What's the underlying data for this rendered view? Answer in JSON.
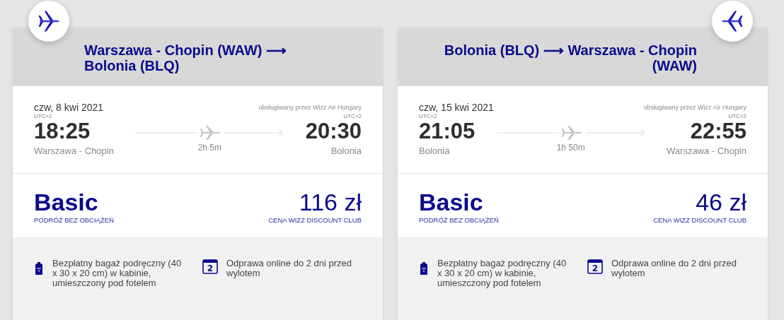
{
  "flights": [
    {
      "kind": "outbound",
      "route": "Warszawa - Chopin (WAW) ⟶ Bolonia (BLQ)",
      "date": "czw, 8 kwi 2021",
      "operator": "obsługiwany przez Wizz Air Hungary",
      "departure": {
        "tz": "UTC+2",
        "time": "18:25",
        "place": "Warszawa - Chopin"
      },
      "duration": "2h 5m",
      "arrival": {
        "tz": "UTC+2",
        "time": "20:30",
        "place": "Bolonia"
      },
      "fare": {
        "name": "Basic",
        "subtitle": "PODRÓŻ BEZ OBCIĄŻEŃ",
        "price": "116 zł",
        "price_note": "CENA WIZZ DISCOUNT CLUB"
      },
      "features": [
        {
          "kind": "baggage",
          "text": "Bezpłatny bagaż podręczny (40 x 30 x 20 cm) w kabinie, umieszczony pod fotelem"
        },
        {
          "kind": "checkin",
          "icon_text": "2",
          "text": "Odprawa online do 2 dni przed wylotem"
        }
      ]
    },
    {
      "kind": "return",
      "route": "Bolonia (BLQ) ⟶ Warszawa - Chopin (WAW)",
      "date": "czw, 15 kwi 2021",
      "operator": "obsługiwany przez Wizz Air Hungary",
      "departure": {
        "tz": "UTC+2",
        "time": "21:05",
        "place": "Bolonia"
      },
      "duration": "1h 50m",
      "arrival": {
        "tz": "UTC+2",
        "time": "22:55",
        "place": "Warszawa - Chopin"
      },
      "fare": {
        "name": "Basic",
        "subtitle": "PODRÓŻ BEZ OBCIĄŻEŃ",
        "price": "46 zł",
        "price_note": "CENA WIZZ DISCOUNT CLUB"
      },
      "features": [
        {
          "kind": "baggage",
          "text": "Bezpłatny bagaż podręczny (40 x 30 x 20 cm) w kabinie, umieszczony pod fotelem"
        },
        {
          "kind": "checkin",
          "icon_text": "2",
          "text": "Odprawa online do 2 dni przed wylotem"
        }
      ]
    }
  ]
}
